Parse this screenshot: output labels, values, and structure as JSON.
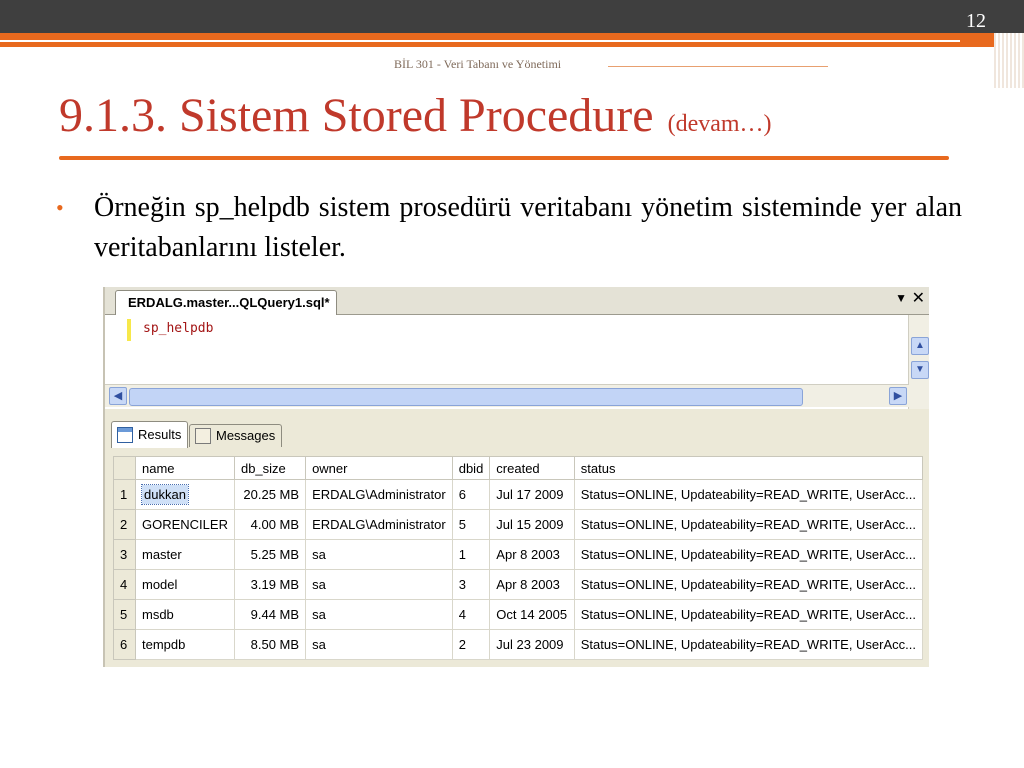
{
  "slide": {
    "page_number": "12",
    "course": "BİL 301 - Veri Tabanı ve Yönetimi",
    "title": "9.1.3. Sistem Stored Procedure",
    "title_suffix": "(devam…)",
    "bullet": "Örneğin sp_helpdb sistem prosedürü veritabanı yönetim sisteminde yer alan veritabanlarını listeler."
  },
  "colors": {
    "accent": "#e8691e",
    "title": "#c0392b",
    "topbar": "#3f3f3f"
  },
  "ssms": {
    "tab_title": "ERDALG.master...QLQuery1.sql*",
    "tab_dropdown_icon": "chevron-down-icon",
    "tab_close_icon": "close-icon",
    "code": "sp_helpdb",
    "result_tabs": [
      {
        "label": "Results",
        "icon": "grid-icon"
      },
      {
        "label": "Messages",
        "icon": "messages-icon"
      }
    ],
    "columns": [
      "name",
      "db_size",
      "owner",
      "dbid",
      "created",
      "status"
    ],
    "rows": [
      {
        "num": "1",
        "name": "dukkan",
        "db_size": "20.25 MB",
        "owner": "ERDALG\\Administrator",
        "dbid": "6",
        "created": "Jul 17 2009",
        "status": "Status=ONLINE, Updateability=READ_WRITE, UserAcc..."
      },
      {
        "num": "2",
        "name": "GORENCILER",
        "db_size": "4.00 MB",
        "owner": "ERDALG\\Administrator",
        "dbid": "5",
        "created": "Jul 15 2009",
        "status": "Status=ONLINE, Updateability=READ_WRITE, UserAcc..."
      },
      {
        "num": "3",
        "name": "master",
        "db_size": "5.25 MB",
        "owner": "sa",
        "dbid": "1",
        "created": "Apr  8 2003",
        "status": "Status=ONLINE, Updateability=READ_WRITE, UserAcc..."
      },
      {
        "num": "4",
        "name": "model",
        "db_size": "3.19 MB",
        "owner": "sa",
        "dbid": "3",
        "created": "Apr  8 2003",
        "status": "Status=ONLINE, Updateability=READ_WRITE, UserAcc..."
      },
      {
        "num": "5",
        "name": "msdb",
        "db_size": "9.44 MB",
        "owner": "sa",
        "dbid": "4",
        "created": "Oct 14 2005",
        "status": "Status=ONLINE, Updateability=READ_WRITE, UserAcc..."
      },
      {
        "num": "6",
        "name": "tempdb",
        "db_size": "8.50 MB",
        "owner": "sa",
        "dbid": "2",
        "created": "Jul 23 2009",
        "status": "Status=ONLINE, Updateability=READ_WRITE, UserAcc..."
      }
    ]
  }
}
